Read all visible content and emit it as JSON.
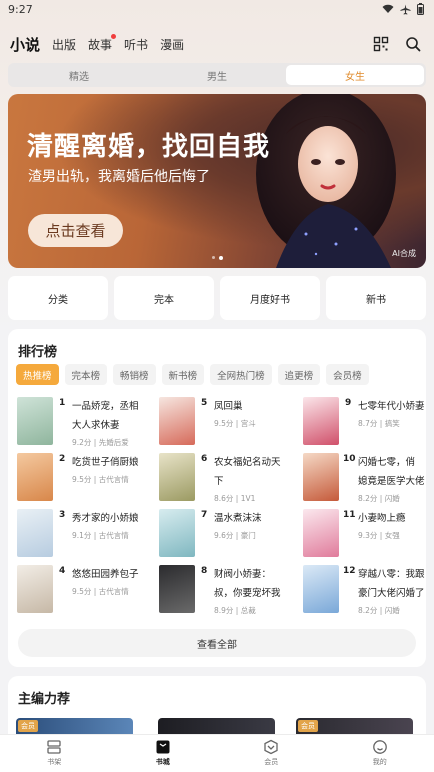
{
  "status": {
    "time": "9:27"
  },
  "topnav": {
    "tabs": [
      {
        "label": "小说",
        "active": true
      },
      {
        "label": "出版"
      },
      {
        "label": "故事",
        "dot": true
      },
      {
        "label": "听书"
      },
      {
        "label": "漫画"
      }
    ],
    "icons": [
      "scan-grid-icon",
      "search-icon"
    ]
  },
  "segment": {
    "items": [
      "精选",
      "男生",
      "女生"
    ],
    "active_index": 2,
    "accent": "#e08b2c"
  },
  "banner": {
    "title": "清醒离婚，找回自我",
    "subtitle": "渣男出轨，我离婚后他后悔了",
    "cta": "点击查看",
    "ai_label": "AI合成"
  },
  "quick_links": [
    "分类",
    "完本",
    "月度好书",
    "新书"
  ],
  "ranking": {
    "heading": "排行榜",
    "chips": [
      "热推榜",
      "完本榜",
      "畅销榜",
      "新书榜",
      "全网热门榜",
      "追更榜",
      "会员榜"
    ],
    "active_chip": 0,
    "columns": [
      [
        {
          "rank": "1",
          "lines": [
            "一品娇宠，丞相",
            "大人求休妻"
          ],
          "meta": "9.2分 | 先婚后爱"
        },
        {
          "rank": "2",
          "lines": [
            "吃货世子俏厨娘"
          ],
          "meta": "9.5分 | 古代言情"
        },
        {
          "rank": "3",
          "lines": [
            "秀才家的小娇娘"
          ],
          "meta": "9.1分 | 古代言情"
        },
        {
          "rank": "4",
          "lines": [
            "悠悠田园养包子"
          ],
          "meta": "9.5分 | 古代言情"
        }
      ],
      [
        {
          "rank": "5",
          "lines": [
            "凤回巢"
          ],
          "meta": "9.5分 | 宫斗"
        },
        {
          "rank": "6",
          "lines": [
            "农女福妃名动天",
            "下"
          ],
          "meta": "8.6分 | 1V1"
        },
        {
          "rank": "7",
          "lines": [
            "温水煮沫沫"
          ],
          "meta": "9.6分 | 豪门"
        },
        {
          "rank": "8",
          "lines": [
            "财阀小娇妻：",
            "叔，你要宠坏我"
          ],
          "meta": "8.9分 | 总裁"
        }
      ],
      [
        {
          "rank": "9",
          "lines": [
            "七零年代小娇妻"
          ],
          "meta": "8.7分 | 搞笑"
        },
        {
          "rank": "10",
          "lines": [
            "闪婚七零，俏",
            "媳竟是医学大佬"
          ],
          "meta": "8.2分 | 闪婚"
        },
        {
          "rank": "11",
          "lines": [
            "小妻吻上瘾"
          ],
          "meta": "9.3分 | 女强"
        },
        {
          "rank": "12",
          "lines": [
            "穿越八零：我跟",
            "豪门大佬闪婚了"
          ],
          "meta": "8.2分 | 闪婚"
        }
      ]
    ],
    "view_all": "查看全部"
  },
  "editor": {
    "heading": "主编力荐",
    "badge": "会员"
  },
  "bottom_nav": [
    {
      "label": "书架",
      "icon": "bookshelf-icon"
    },
    {
      "label": "书城",
      "icon": "bookstore-icon",
      "active": true
    },
    {
      "label": "会员",
      "icon": "vip-icon"
    },
    {
      "label": "我的",
      "icon": "profile-icon"
    }
  ]
}
